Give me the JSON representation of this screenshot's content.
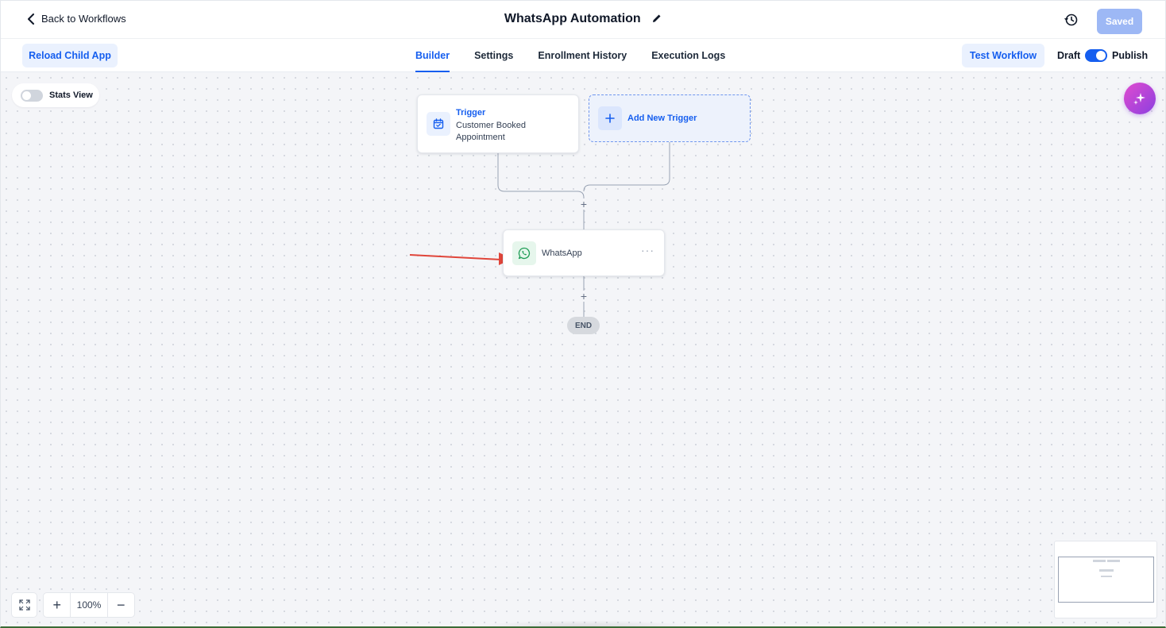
{
  "header": {
    "back_label": "Back to Workflows",
    "title": "WhatsApp Automation",
    "saved_label": "Saved"
  },
  "subbar": {
    "reload_label": "Reload Child App",
    "tabs": [
      {
        "label": "Builder",
        "active": true
      },
      {
        "label": "Settings",
        "active": false
      },
      {
        "label": "Enrollment History",
        "active": false
      },
      {
        "label": "Execution Logs",
        "active": false
      }
    ],
    "test_label": "Test Workflow",
    "draft_label": "Draft",
    "publish_label": "Publish",
    "publish_on": true
  },
  "canvas": {
    "stats_label": "Stats View",
    "stats_on": false,
    "trigger": {
      "title": "Trigger",
      "description": "Customer Booked Appointment"
    },
    "add_trigger_label": "Add New Trigger",
    "action": {
      "label": "WhatsApp",
      "more": "···"
    },
    "end_label": "END",
    "zoom": "100%"
  },
  "colors": {
    "accent": "#155eef",
    "saved_button": "#9db8f5",
    "arrow": "#e0453a",
    "whatsapp": "#1f9d55"
  },
  "icons": {
    "back": "chevron-left-icon",
    "edit": "pencil-icon",
    "history": "history-icon",
    "ai": "sparkle-icon",
    "trigger": "calendar-check-icon",
    "add": "plus-icon",
    "whatsapp": "whatsapp-icon",
    "fit": "expand-icon"
  }
}
